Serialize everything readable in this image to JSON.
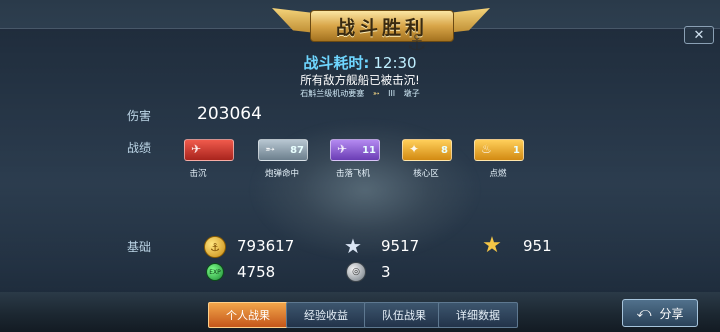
{
  "banner": {
    "title": "战斗胜利"
  },
  "battle": {
    "time_label": "战斗耗时:",
    "time_value": "12:30",
    "result_text": "所有敌方舰船已被击沉!",
    "ship_class": "石斛兰级机动要塞",
    "ship_tier": "III",
    "ship_name": "墩子"
  },
  "stats": {
    "damage_label": "伤害",
    "damage_value": "203064",
    "medals_label": "战绩",
    "medals": [
      {
        "caption": "击沉",
        "count": "",
        "color": "#d43b34",
        "icon": "plane-sink-icon"
      },
      {
        "caption": "炮弹命中",
        "count": "87",
        "color": "#8fa3b3",
        "icon": "shell-hit-icon"
      },
      {
        "caption": "击落飞机",
        "count": "11",
        "color": "#8d5bd6",
        "icon": "plane-down-icon"
      },
      {
        "caption": "核心区",
        "count": "8",
        "color": "#f0a524",
        "icon": "core-zone-icon"
      },
      {
        "caption": "点燃",
        "count": "1",
        "color": "#f0a524",
        "icon": "fire-icon"
      }
    ],
    "base_label": "基础",
    "resources": {
      "coins": "793617",
      "silver_star": "9517",
      "gold_star": "951",
      "exp": "4758",
      "ball": "3"
    }
  },
  "tabs": [
    {
      "label": "个人战果",
      "active": true
    },
    {
      "label": "经验收益",
      "active": false
    },
    {
      "label": "队伍战果",
      "active": false
    },
    {
      "label": "详细数据",
      "active": false
    }
  ],
  "share": {
    "label": "分享"
  },
  "close": {
    "label": "✕"
  }
}
